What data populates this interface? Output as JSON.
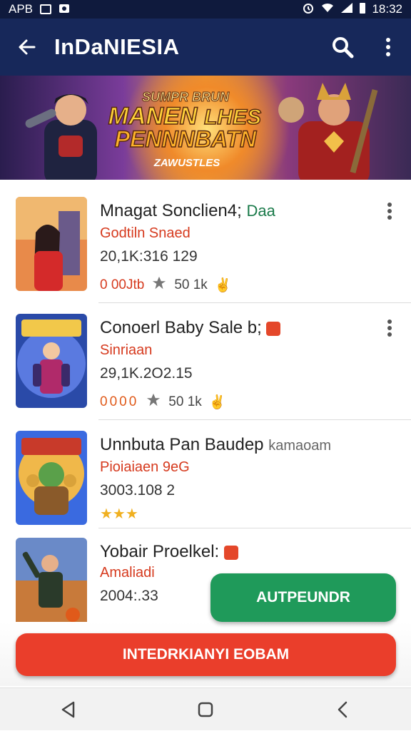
{
  "status_bar": {
    "carrier": "APB",
    "time": "18:32"
  },
  "app_bar": {
    "title": "InDaNIESIA"
  },
  "banner": {
    "subtitle": "ZAWUSTLES",
    "title_line1": "SUMPR BRUN",
    "title_line2": "MANEN",
    "title_line3": "LHES",
    "title_line4": "PENNNBATN"
  },
  "games": [
    {
      "name": "Mnagat Sonclien4;",
      "tag": "Daa",
      "subtitle": "Godtiln Snaed",
      "meta": "20,1K:316 129",
      "rating_prefix": "0 00Jtb",
      "rating": "50 1k"
    },
    {
      "name": "Conoerl Baby Sale b;",
      "tag": "",
      "subtitle": "Sinriaan",
      "meta": "29,1K.2O2.15",
      "rating_prefix": "0000",
      "rating": "50 1k"
    },
    {
      "name": "Unnbuta Pan Baudep",
      "tag": "kamaoam",
      "subtitle": "Pioiaiaen 9eG",
      "meta": "3003.108 2",
      "rating_prefix": "★★★",
      "rating": ""
    },
    {
      "name": "Yobair Proelkel:",
      "tag": "",
      "subtitle": "Amaliadi",
      "meta": "2004:.33",
      "rating_prefix": "",
      "rating": ""
    }
  ],
  "buttons": {
    "install": "AUTPEUNDR",
    "cta": "INTEDRKIANYI EOBAM"
  },
  "colors": {
    "app_bar": "#17285a",
    "accent_red": "#ea3e2b",
    "accent_green": "#1f9a5a"
  }
}
